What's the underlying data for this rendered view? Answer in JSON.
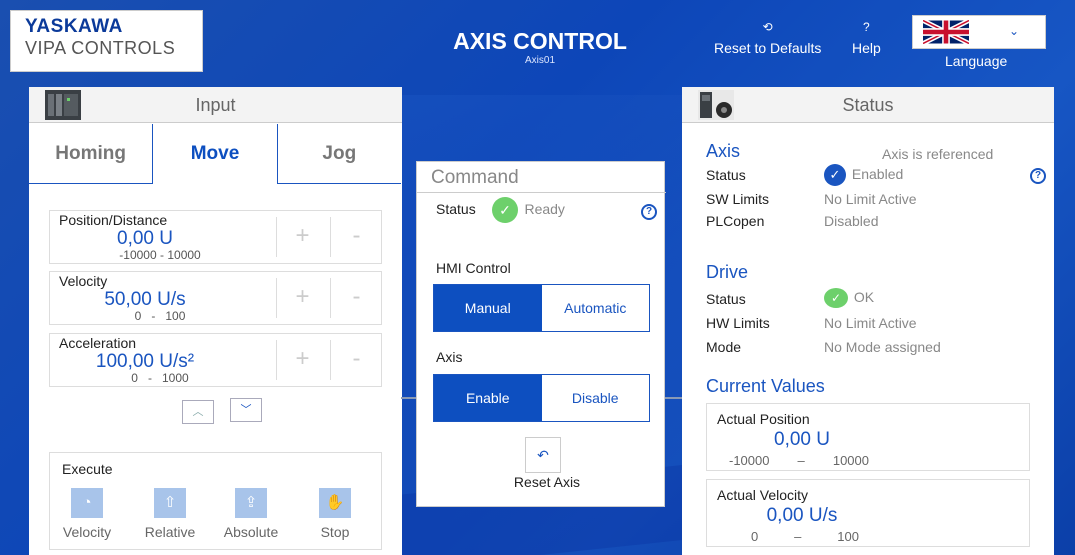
{
  "header": {
    "logo_top": "YASKAWA",
    "logo_bottom": "VIPA CONTROLS",
    "title": "AXIS CONTROL",
    "subtitle": "Axis01",
    "reset_label": "Reset to Defaults",
    "help_label": "Help",
    "language_label": "Language"
  },
  "input_panel": {
    "title": "Input",
    "tabs": [
      "Homing",
      "Move",
      "Jog"
    ],
    "params": [
      {
        "name": "Position/Distance",
        "value": "0,00 U",
        "min": "-10000",
        "sep": "-",
        "max": "10000"
      },
      {
        "name": "Velocity",
        "value": "50,00 U/s",
        "min": "0",
        "sep": "-",
        "max": "100"
      },
      {
        "name": "Acceleration",
        "value": "100,00 U/s²",
        "min": "0",
        "sep": "-",
        "max": "1000"
      }
    ],
    "plus": "+",
    "minus": "-",
    "execute": {
      "title": "Execute",
      "items": [
        "Velocity",
        "Relative",
        "Absolute",
        "Stop"
      ]
    }
  },
  "command_panel": {
    "title": "Command",
    "status_label": "Status",
    "status_value": "Ready",
    "hmi_label": "HMI Control",
    "hmi_options": [
      "Manual",
      "Automatic"
    ],
    "axis_label": "Axis",
    "axis_options": [
      "Enable",
      "Disable"
    ],
    "reset_axis": "Reset Axis"
  },
  "status_panel": {
    "title": "Status",
    "axis": {
      "title": "Axis",
      "referenced": "Axis is referenced",
      "status_label": "Status",
      "status_value": "Enabled",
      "sw_label": "SW Limits",
      "sw_value": "No Limit Active",
      "plc_label": "PLCopen",
      "plc_value": "Disabled"
    },
    "drive": {
      "title": "Drive",
      "status_label": "Status",
      "status_value": "OK",
      "hw_label": "HW Limits",
      "hw_value": "No Limit Active",
      "mode_label": "Mode",
      "mode_value": "No Mode assigned"
    },
    "current": {
      "title": "Current Values",
      "position": {
        "name": "Actual Position",
        "value": "0,00 U",
        "min": "-10000",
        "sep": "–",
        "max": "10000"
      },
      "velocity": {
        "name": "Actual Velocity",
        "value": "0,00 U/s",
        "min": "0",
        "sep": "–",
        "max": "100"
      }
    }
  },
  "colors": {
    "accent": "#1a55c0",
    "ok": "#6dd06b",
    "background": "#0d46b8"
  }
}
